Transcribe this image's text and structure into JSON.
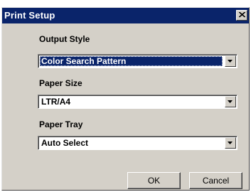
{
  "window": {
    "title": "Print Setup",
    "close_icon": "close-icon"
  },
  "output_style": {
    "label": "Output Style",
    "value": "Color Search Pattern",
    "highlighted": true
  },
  "paper_size": {
    "label": "Paper Size",
    "value": "LTR/A4"
  },
  "paper_tray": {
    "label": "Paper Tray",
    "value": "Auto Select"
  },
  "buttons": {
    "ok_label": "OK",
    "cancel_label": "Cancel"
  },
  "colors": {
    "titlebar": "#0a246a",
    "dialog_face": "#d4d0c8",
    "selection": "#0a246a"
  }
}
